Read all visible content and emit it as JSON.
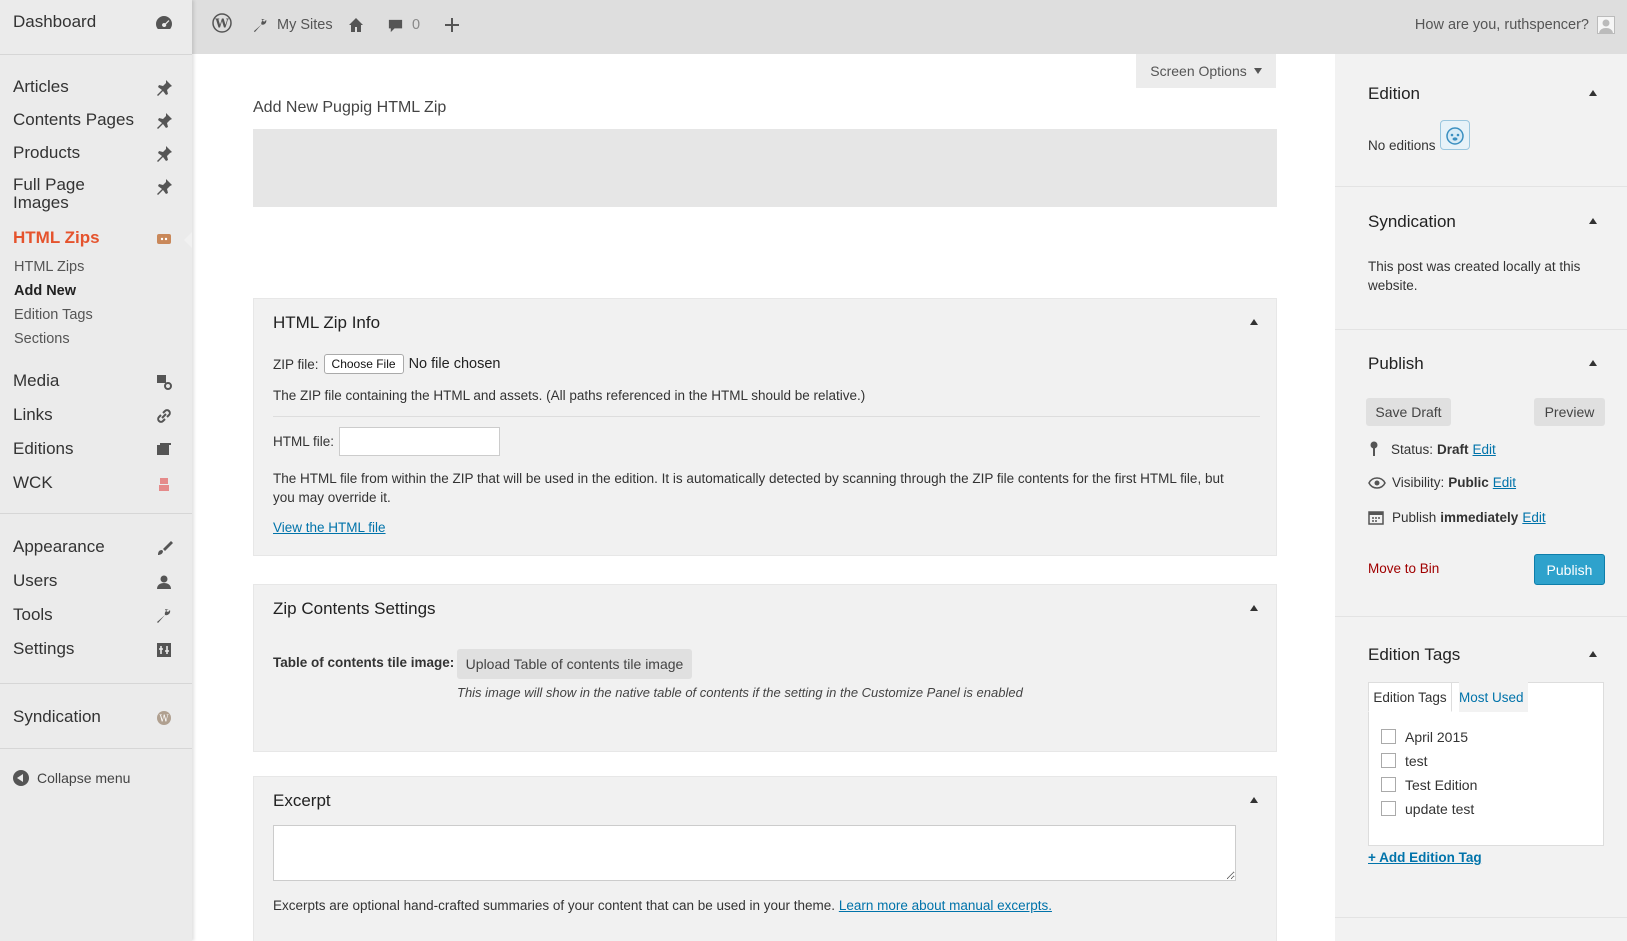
{
  "sidebar": {
    "dashboard": "Dashboard",
    "articles": "Articles",
    "contents_pages": "Contents Pages",
    "products": "Products",
    "full_page_images": "Full Page Images",
    "html_zips": "HTML Zips",
    "submenu": {
      "html_zips": "HTML Zips",
      "add_new": "Add New",
      "edition_tags": "Edition Tags",
      "sections": "Sections"
    },
    "media": "Media",
    "links": "Links",
    "editions": "Editions",
    "wck": "WCK",
    "appearance": "Appearance",
    "users": "Users",
    "tools": "Tools",
    "settings": "Settings",
    "syndication": "Syndication",
    "collapse_menu": "Collapse menu"
  },
  "topbar": {
    "my_sites": "My Sites",
    "comments_count": "0",
    "greeting": "How are you, ruthspencer?"
  },
  "main": {
    "screen_options": "Screen Options",
    "page_title": "Add New Pugpig HTML Zip",
    "html_zip_info": {
      "title": "HTML Zip Info",
      "zip_label": "ZIP file:",
      "choose_file": "Choose File",
      "no_file": "No file chosen",
      "zip_desc": "The ZIP file containing the HTML and assets. (All paths referenced in the HTML should be relative.)",
      "html_label": "HTML file:",
      "html_value": "",
      "html_desc": "The HTML file from within the ZIP that will be used in the edition. It is automatically detected by scanning through the ZIP file contents for the first HTML file, but you may override it.",
      "view_link": "View the HTML file"
    },
    "zip_contents": {
      "title": "Zip Contents Settings",
      "toc_label": "Table of contents tile image:",
      "upload_button": "Upload Table of contents tile image",
      "note": "This image will show in the native table of contents if the setting in the Customize Panel is enabled"
    },
    "excerpt": {
      "title": "Excerpt",
      "value": "",
      "desc": "Excerpts are optional hand-crafted summaries of your content that can be used in your theme.",
      "link": "Learn more about manual excerpts."
    }
  },
  "right": {
    "edition": {
      "title": "Edition",
      "text": "No editions"
    },
    "syndication": {
      "title": "Syndication",
      "text": "This post was created locally at this website."
    },
    "publish": {
      "title": "Publish",
      "save_draft": "Save Draft",
      "preview": "Preview",
      "status_label": "Status:",
      "status_value": "Draft",
      "visibility_label": "Visibility:",
      "visibility_value": "Public",
      "publish_label": "Publish",
      "publish_value": "immediately",
      "edit": "Edit",
      "move_to_bin": "Move to Bin",
      "publish_button": "Publish"
    },
    "edition_tags": {
      "title": "Edition Tags",
      "tab_all": "Edition Tags",
      "tab_most_used": "Most Used",
      "tags": [
        "April 2015",
        "test",
        "Test Edition",
        "update test"
      ],
      "add_link": "+ Add Edition Tag"
    }
  },
  "colors": {
    "current_menu": "#e5532d",
    "link": "#0073aa",
    "publish_button": "#2ea2cc",
    "move_to_bin": "#a00000"
  }
}
